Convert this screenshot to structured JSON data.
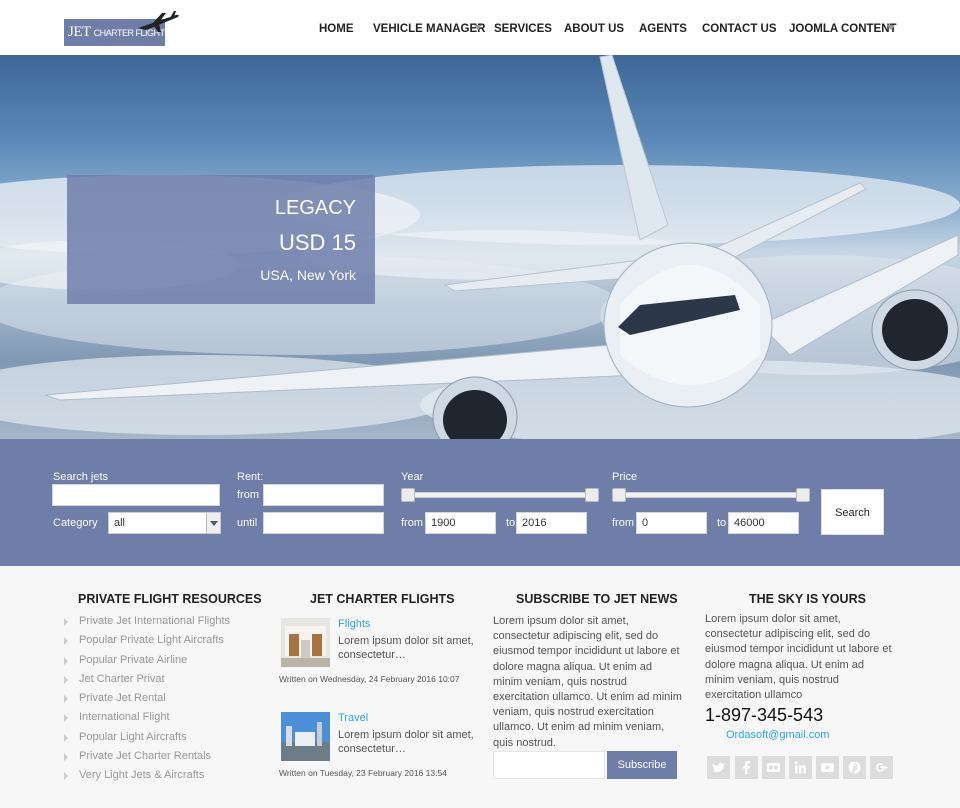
{
  "header": {
    "logo_main": "JET",
    "logo_sub": "CHARTER FLIGHTS",
    "nav": [
      {
        "label": "HOME",
        "has_dropdown": false
      },
      {
        "label": "VEHICLE MANAGER",
        "has_dropdown": true
      },
      {
        "label": "SERVICES",
        "has_dropdown": false
      },
      {
        "label": "ABOUT US",
        "has_dropdown": false
      },
      {
        "label": "AGENTS",
        "has_dropdown": false
      },
      {
        "label": "CONTACT US",
        "has_dropdown": false
      },
      {
        "label": "JOOMLA CONTENT",
        "has_dropdown": true
      }
    ]
  },
  "hero": {
    "title": "LEGACY",
    "price": "USD 15",
    "location": "USA, New York"
  },
  "search": {
    "search_jets_label": "Search jets",
    "category_label": "Category",
    "category_value": "all",
    "rent_label": "Rent:",
    "from_label": "from",
    "until_label": "until",
    "year_label": "Year",
    "year_from_label": "from",
    "year_from": "1900",
    "year_to_label": "to",
    "year_to": "2016",
    "price_label": "Price",
    "price_from_label": "from",
    "price_from": "0",
    "price_to_label": "to",
    "price_to": "46000",
    "button": "Search"
  },
  "resources": {
    "title": "PRIVATE FLIGHT RESOURCES",
    "items": [
      "Private Jet International Flights",
      "Popular Private Light Aircrafts",
      "Popular Private Airline",
      "Jet Charter Privat",
      "Private Jet Rental",
      "International Flight",
      "Popular Light Aircrafts",
      "Private Jet Charter Rentals",
      "Very Light Jets & Aircrafts"
    ]
  },
  "articles": {
    "title": "JET CHARTER FLIGHTS",
    "items": [
      {
        "title": "Flights",
        "text": "Lorem ipsum dolor sit amet, consectetur…",
        "date": "Written on Wednesday, 24 February 2016 10:07"
      },
      {
        "title": "Travel",
        "text": "Lorem ipsum dolor sit amet, consectetur…",
        "date": "Written on Tuesday, 23 February 2016 13:54"
      }
    ]
  },
  "subscribe": {
    "title": "SUBSCRIBE TO JET NEWS",
    "text": "Lorem ipsum dolor sit amet, consectetur adipiscing elit, sed do eiusmod tempor incididunt ut labore et dolore magna aliqua. Ut enim ad minim veniam, quis nostrud exercitation ullamco. Ut enim ad minim veniam, quis nostrud exercitation ullamco. Ut enim ad minim veniam, quis nostrud.",
    "button": "Subscribe"
  },
  "sky": {
    "title": "THE SKY IS YOURS",
    "text": "Lorem ipsum dolor sit amet, consectetur adipiscing elit, sed do eiusmod tempor incididunt ut labore et dolore magna aliqua. Ut enim ad minim veniam, quis nostrud exercitation ullamco",
    "phone": "1-897-345-543",
    "email": "Ordasoft@gmail.com",
    "social": [
      "twitter-icon",
      "facebook-icon",
      "flickr-icon",
      "linkedin-icon",
      "youtube-icon",
      "pinterest-icon",
      "google-plus-icon"
    ]
  },
  "colors": {
    "accent": "#6f7ea8",
    "link": "#2aa8e0"
  }
}
